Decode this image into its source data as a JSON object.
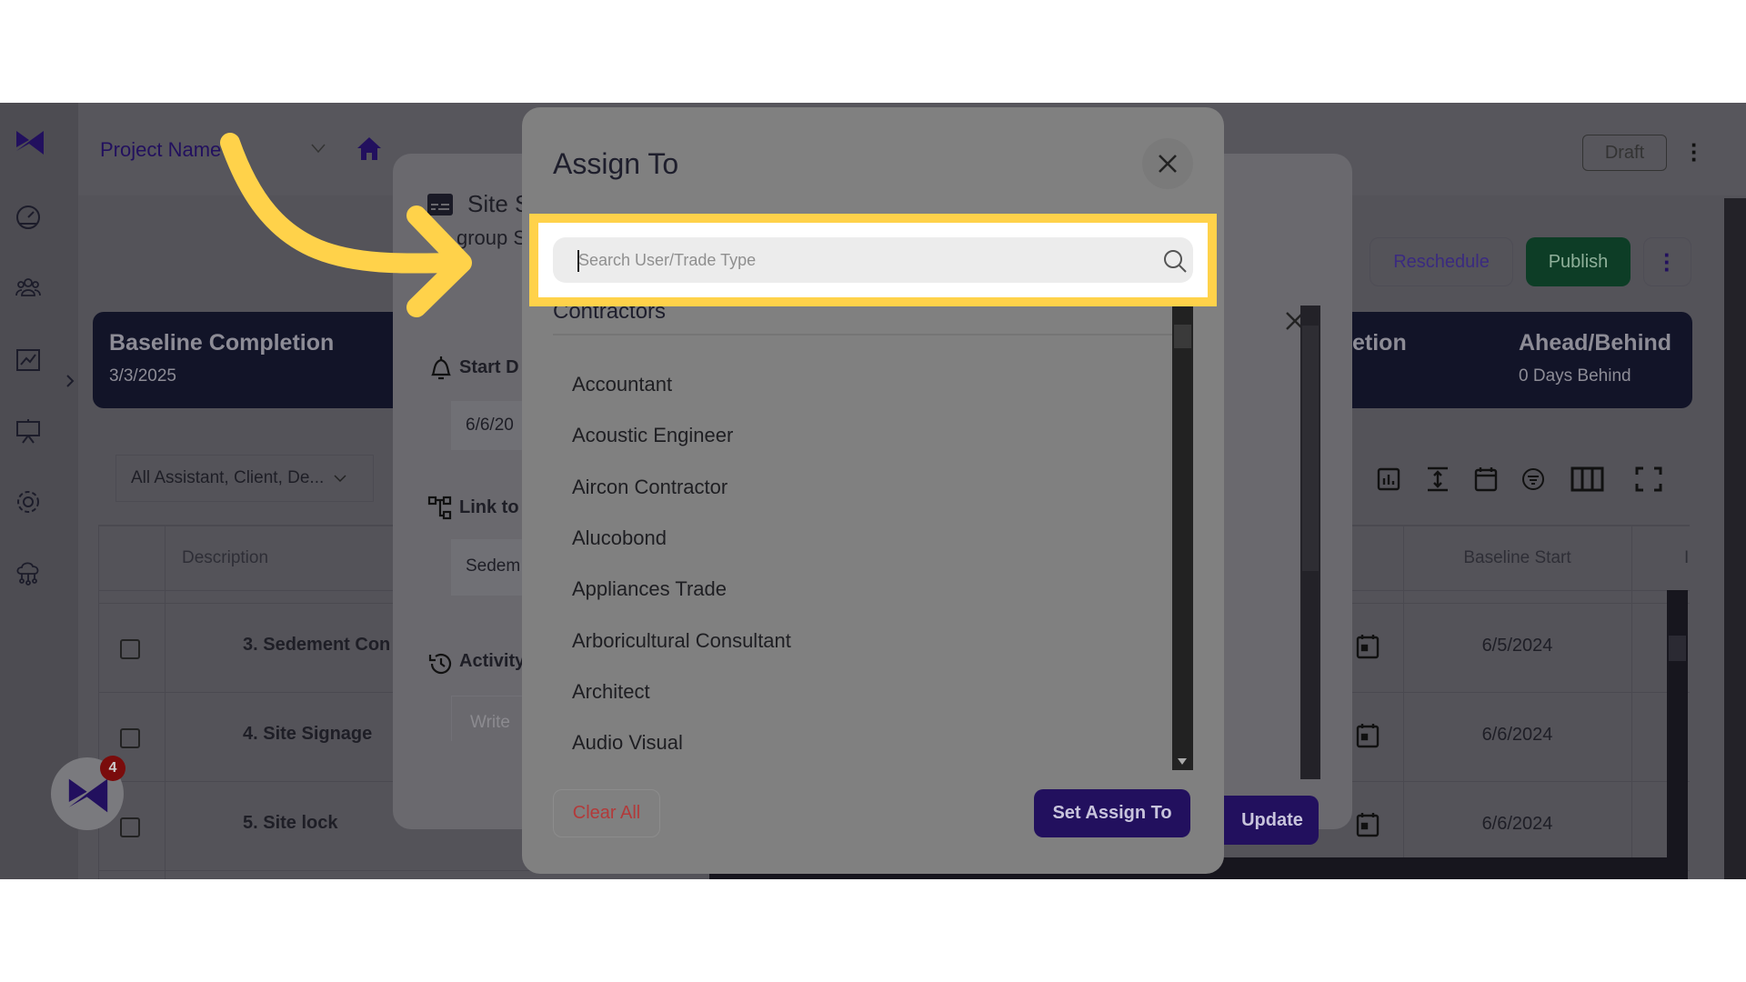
{
  "header": {
    "project_name": "Project Name",
    "draft_label": "Draft"
  },
  "actions": {
    "reschedule": "Reschedule",
    "publish": "Publish"
  },
  "summary": {
    "baseline_completion_label": "Baseline Completion",
    "baseline_completion_value": "3/3/2025",
    "partial_label": "etion",
    "ahead_behind_label": "Ahead/Behind",
    "ahead_behind_value": "0 Days Behind"
  },
  "filter": {
    "value": "All Assistant, Client, De..."
  },
  "table": {
    "columns": [
      "Description",
      "Baseline Start",
      "I"
    ],
    "rows": [
      {
        "description": "3. Sedement Con",
        "baseline_start": "6/5/2024"
      },
      {
        "description": "4. Site Signage",
        "baseline_start": "6/6/2024"
      },
      {
        "description": "5. Site lock",
        "baseline_start": "6/6/2024"
      }
    ]
  },
  "task_panel": {
    "title": "Site S",
    "subtitle": "group S",
    "start_label": "Start D",
    "start_value": "6/6/20",
    "link_label": "Link to",
    "link_value": "Sedem",
    "activity_label": "Activity",
    "activity_placeholder": "Write",
    "update_label": "Update"
  },
  "assign_modal": {
    "title": "Assign To",
    "search_placeholder": "Search User/Trade Type",
    "section": "Contractors",
    "items": [
      "Accountant",
      "Acoustic Engineer",
      "Aircon Contractor",
      "Alucobond",
      "Appliances Trade",
      "Arboricultural Consultant",
      "Architect",
      "Audio Visual"
    ],
    "clear_all": "Clear All",
    "set_assign": "Set Assign To"
  },
  "chat": {
    "badge_count": "4"
  },
  "colors": {
    "highlight": "#ffd24a",
    "primary": "#22105e",
    "publish": "#0d3d26",
    "danger": "#b23a3a"
  }
}
